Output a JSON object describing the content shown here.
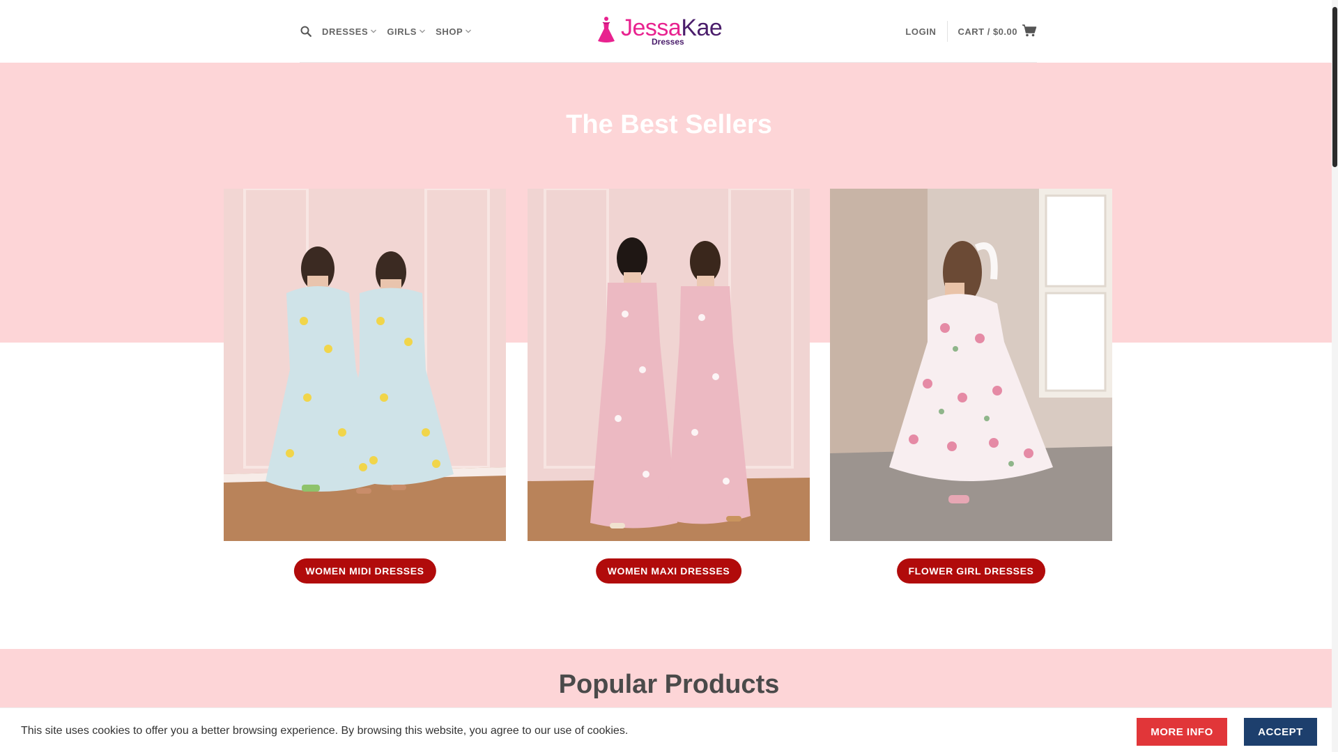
{
  "header": {
    "nav": [
      {
        "label": "DRESSES",
        "icon": "chevron-down-icon"
      },
      {
        "label": "GIRLS",
        "icon": "chevron-down-icon"
      },
      {
        "label": "SHOP",
        "icon": "chevron-down-icon"
      }
    ],
    "logo": {
      "main_part1": "Jessa",
      "main_part2": "Kae",
      "sub": "Dresses"
    },
    "login_label": "LOGIN",
    "cart_label": "CART / $0.00"
  },
  "best_sellers": {
    "title": "The Best Sellers",
    "cards": [
      {
        "button_label": "WOMEN MIDI DRESSES"
      },
      {
        "button_label": "WOMEN MAXI DRESSES"
      },
      {
        "button_label": "FLOWER GIRL DRESSES"
      }
    ]
  },
  "popular": {
    "title": "Popular Products"
  },
  "cookie_bar": {
    "text": "This site uses cookies to offer you a better browsing experience. By browsing this website, you agree to our use of cookies.",
    "more_info_label": "MORE INFO",
    "accept_label": "ACCEPT"
  },
  "colors": {
    "band_pink": "#fdd5d7",
    "button_red": "#b10b0b",
    "more_info_red": "#e13639",
    "accept_navy": "#1d3f6d",
    "logo_pink": "#e8228f",
    "logo_purple": "#4a1d6b"
  }
}
